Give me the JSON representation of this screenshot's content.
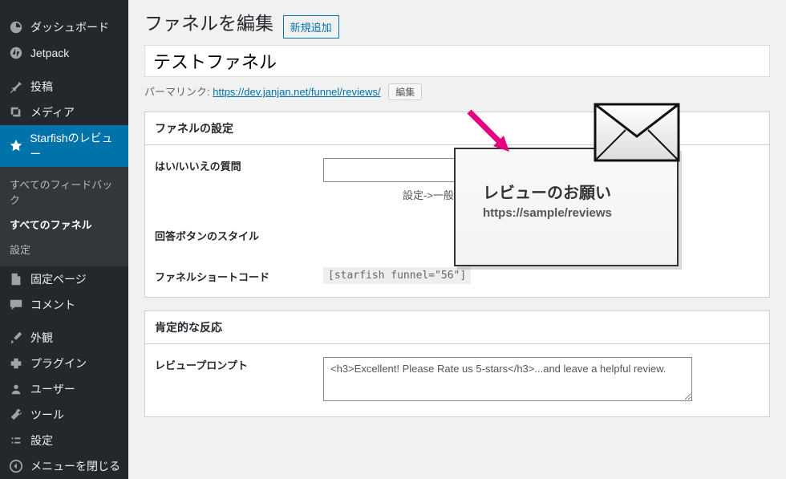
{
  "sidebar": {
    "dashboard": "ダッシュボード",
    "jetpack": "Jetpack",
    "posts": "投稿",
    "media": "メディア",
    "starfish": "Starfishのレビュー",
    "feedback": "すべてのフィードバック",
    "funnels": "すべてのファネル",
    "settings_sub": "設定",
    "pages": "固定ページ",
    "comments": "コメント",
    "appearance": "外観",
    "plugins": "プラグイン",
    "users": "ユーザー",
    "tools": "ツール",
    "settings": "設定",
    "collapse": "メニューを閉じる"
  },
  "page": {
    "title": "ファネルを編集",
    "add_new": "新規追加",
    "post_title": "テストファネル",
    "permalink_label": "パーマリンク:",
    "permalink_base": "https://dev.janjan.net/funnel/",
    "permalink_slug": "reviews",
    "permalink_slash": "/",
    "edit_btn": "編集"
  },
  "box1": {
    "header": "ファネルの設定",
    "q_label": "はい/いいえの質問",
    "q_value": "",
    "q_desc": "設定->一般で設定されたサイト名を使用します。",
    "style_label": "回答ボタンのスタイル",
    "shortcode_label": "ファネルショートコード",
    "shortcode_value": "[starfish funnel=\"56\"]"
  },
  "box2": {
    "header": "肯定的な反応",
    "prompt_label": "レビュープロンプト",
    "prompt_value": "<h3>Excellent! Please Rate us 5-stars</h3>...and leave a helpful review."
  },
  "overlay": {
    "title": "レビューのお願い",
    "url": "https://sample/reviews"
  }
}
